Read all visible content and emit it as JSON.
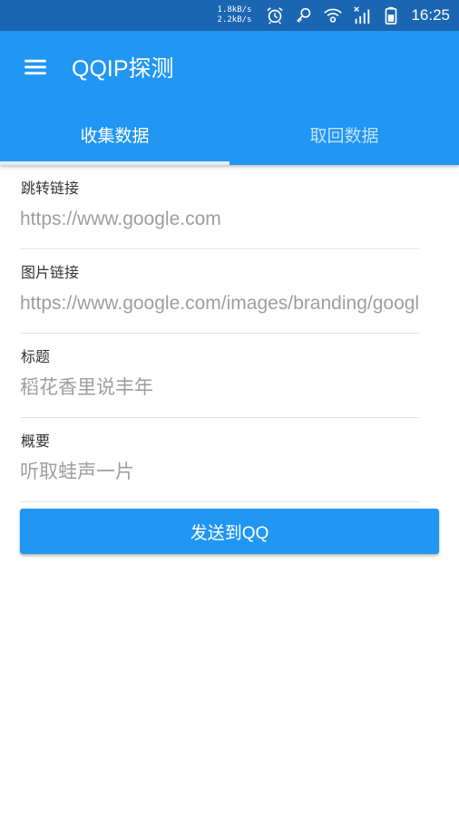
{
  "status_bar": {
    "upload_speed": "1.8kB/s",
    "download_speed": "2.2kB/s",
    "icons": [
      "alarm-icon",
      "key-icon",
      "wifi-icon",
      "signal-icon",
      "battery-icon"
    ],
    "time": "16:25",
    "background_color": "#1a66b3"
  },
  "app_bar": {
    "title": "QQIP探测",
    "menu_icon": "menu-icon",
    "background_color": "#2196f3"
  },
  "tabs": [
    {
      "label": "收集数据",
      "selected": true
    },
    {
      "label": "取回数据",
      "selected": false
    }
  ],
  "form": {
    "fields": [
      {
        "label": "跳转链接",
        "placeholder": "https://www.google.com"
      },
      {
        "label": "图片链接",
        "placeholder": "https://www.google.com/images/branding/googlelogo"
      },
      {
        "label": "标题",
        "placeholder": "稻花香里说丰年"
      },
      {
        "label": "概要",
        "placeholder": "听取蛙声一片"
      }
    ]
  },
  "send_button": {
    "label": "发送到QQ",
    "color": "#2196f3"
  }
}
